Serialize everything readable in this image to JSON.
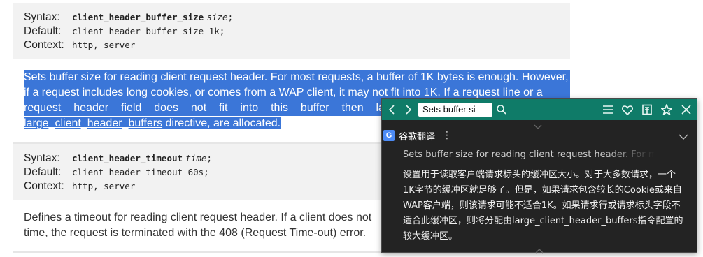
{
  "directive1": {
    "syntax_label": "Syntax:",
    "syntax_name": "client_header_buffer_size",
    "syntax_arg": "size",
    "syntax_end": ";",
    "default_label": "Default:",
    "default_value": "client_header_buffer_size 1k;",
    "context_label": "Context:",
    "context_value": "http, server"
  },
  "description1": {
    "lines": [
      "Sets buffer size for reading client request header. For most requests, a buffer of 1K bytes is enough. However,",
      "if a request includes long cookies, or comes from a WAP client, it may not fit into 1K. If a request line or a"
    ],
    "line3_words": [
      "request",
      "header",
      "field",
      "does",
      "not",
      "fit",
      "into",
      "this",
      "buffer",
      "then",
      "la"
    ],
    "line4_link": "large_client_header_buffers",
    "line4_rest": " directive, are allocated."
  },
  "directive2": {
    "syntax_label": "Syntax:",
    "syntax_name": "client_header_timeout",
    "syntax_arg": "time",
    "syntax_end": ";",
    "default_label": "Default:",
    "default_value": "client_header_timeout 60s;",
    "context_label": "Context:",
    "context_value": "http, server"
  },
  "description2": {
    "line1": "Defines a timeout for reading client request header. If a client does not",
    "line2": "time, the request is terminated with the 408 (Request Time-out) error."
  },
  "popup": {
    "search_value": "Sets buffer si",
    "engine_name": "谷歌翻译",
    "engine_icon_letter": "G",
    "menu_glyph": "⋮",
    "source_text": "Sets buffer size for reading client request header. For most re",
    "translation_lines": [
      "设置用于读取客户端请求标头的缓冲区大小。对于大多数请求，一个",
      "1K字节的缓冲区就足够了。但是，如果请求包含较长的Cookie或来自",
      "WAP客户端，则该请求可能不适合1K。如果请求行或请求标头字段不",
      "适合此缓冲区，则将分配由large_client_header_buffers指令配置的",
      "较大缓冲区。"
    ],
    "icons": [
      "chevron-left-icon",
      "chevron-right-icon",
      "search-icon",
      "menu-icon",
      "heart-icon",
      "dictionary-icon",
      "pin-icon",
      "close-icon"
    ],
    "accent_color": "#0f7b68"
  }
}
